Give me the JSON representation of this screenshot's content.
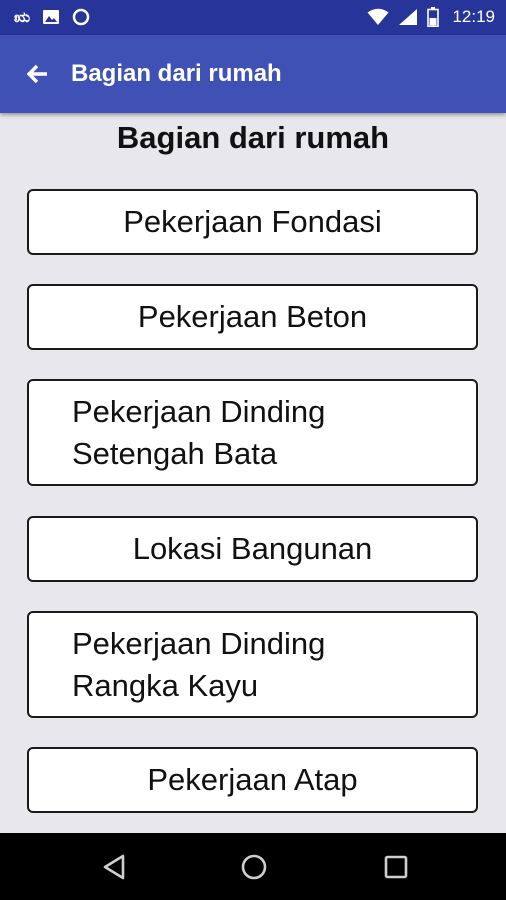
{
  "status_bar": {
    "left_glyph": "ಋ",
    "time": "12:19",
    "icons": [
      "image-notification-icon",
      "circle-notification-icon",
      "wifi-icon",
      "signal-icon",
      "battery-icon"
    ]
  },
  "app_bar": {
    "back_icon": "arrow-left-icon",
    "title": "Bagian dari rumah"
  },
  "page": {
    "heading": "Bagian dari rumah"
  },
  "menu": [
    {
      "label": "Pekerjaan Fondasi"
    },
    {
      "label": "Pekerjaan Beton"
    },
    {
      "line1": "Pekerjaan Dinding",
      "line2": "Setengah Bata"
    },
    {
      "label": "Lokasi Bangunan"
    },
    {
      "line1": "Pekerjaan Dinding",
      "line2": "Rangka Kayu"
    },
    {
      "label": "Pekerjaan Atap"
    }
  ],
  "nav_bar": {
    "icons": [
      "back-triangle-icon",
      "home-circle-icon",
      "recents-square-icon"
    ]
  },
  "colors": {
    "status_bar": "#27349a",
    "app_bar": "#3f51b5",
    "background": "#e7e7ec",
    "button_bg": "#ffffff",
    "button_border": "#1a1a1a",
    "nav_bar": "#000000"
  }
}
